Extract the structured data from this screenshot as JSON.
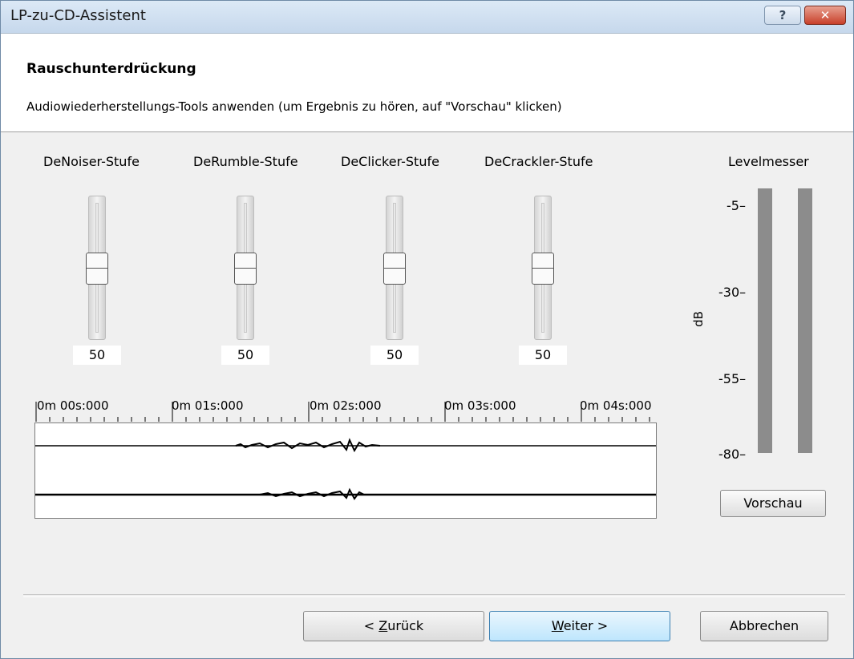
{
  "window": {
    "title": "LP-zu-CD-Assistent",
    "help_label": "?",
    "close_label": "✕"
  },
  "header": {
    "title": "Rauschunterdrückung",
    "description": "Audiowiederherstellungs-Tools anwenden (um Ergebnis zu hören, auf \"Vorschau\" klicken)"
  },
  "sliders": [
    {
      "label": "DeNoiser-Stufe",
      "value": "50",
      "level": 0.5
    },
    {
      "label": "DeRumble-Stufe",
      "value": "50",
      "level": 0.5
    },
    {
      "label": "DeClicker-Stufe",
      "value": "50",
      "level": 0.5
    },
    {
      "label": "DeCrackler-Stufe",
      "value": "50",
      "level": 0.5
    }
  ],
  "timeline": {
    "ticks": [
      "0m 00s:000",
      "0m 01s:000",
      "0m 02s:000",
      "0m 03s:000",
      "0m 04s:000"
    ]
  },
  "level_meter": {
    "label": "Levelmesser",
    "unit": "dB",
    "scale": [
      "-5",
      "-30",
      "-55",
      "-80"
    ],
    "bar_color": "#8c8c8c"
  },
  "buttons": {
    "preview": "Vorschau",
    "back_prefix": "< ",
    "back_accel": "Z",
    "back_rest": "urück",
    "next_accel": "W",
    "next_rest": "eiter >",
    "cancel": "Abbrechen"
  },
  "colors": {
    "accent": "#3c7fb1",
    "close": "#c8402a"
  }
}
